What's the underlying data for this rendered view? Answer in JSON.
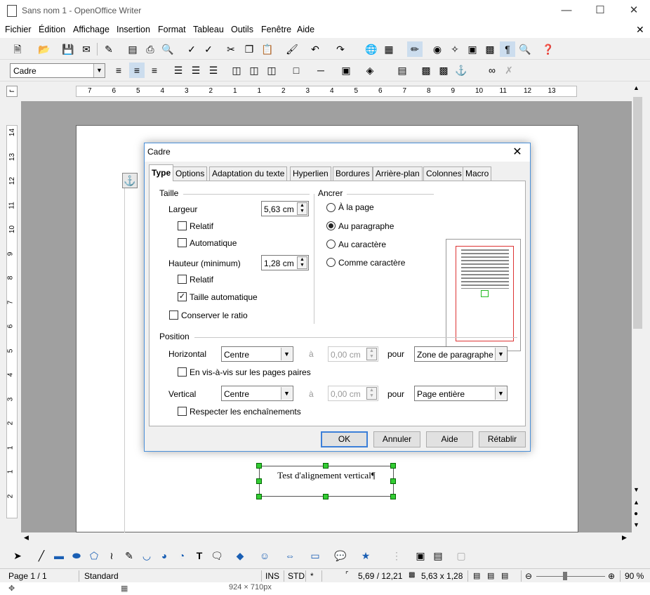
{
  "window": {
    "title": "Sans nom 1 - OpenOffice Writer"
  },
  "menubar": [
    "Fichier",
    "Édition",
    "Affichage",
    "Insertion",
    "Format",
    "Tableau",
    "Outils",
    "Fenêtre",
    "Aide"
  ],
  "format_toolbar": {
    "style": "Cadre"
  },
  "hruler": {
    "labels": [
      "7",
      "6",
      "5",
      "4",
      "3",
      "2",
      "1",
      "1",
      "2",
      "3",
      "4",
      "5",
      "6",
      "7",
      "8",
      "9",
      "10",
      "11",
      "12",
      "13"
    ]
  },
  "vruler": {
    "labels": [
      "14",
      "13",
      "12",
      "11",
      "10",
      "9",
      "8",
      "7",
      "6",
      "5",
      "4",
      "3",
      "2",
      "1",
      "1",
      "2"
    ]
  },
  "document": {
    "frame_text": "Test d'alignement vertical¶"
  },
  "statusbar": {
    "page": "Page 1 / 1",
    "style": "Standard",
    "ins": "INS",
    "std": "STD",
    "star": "*",
    "position": "5,69 / 12,21",
    "size": "5,63 x 1,28",
    "zoom": "90 %"
  },
  "taskstrip": {
    "text": "924 × 710px"
  },
  "dialog": {
    "title": "Cadre",
    "tabs": [
      "Type",
      "Options",
      "Adaptation du texte",
      "Hyperlien",
      "Bordures",
      "Arrière-plan",
      "Colonnes",
      "Macro"
    ],
    "taille": {
      "heading": "Taille",
      "largeur_label": "Largeur",
      "largeur_value": "5,63 cm",
      "relatif1": "Relatif",
      "automatique": "Automatique",
      "hauteur_label": "Hauteur (minimum)",
      "hauteur_value": "1,28 cm",
      "relatif2": "Relatif",
      "taille_auto": "Taille automatique",
      "conserver": "Conserver le ratio"
    },
    "ancrer": {
      "heading": "Ancrer",
      "opt_page": "À la page",
      "opt_paragraphe": "Au paragraphe",
      "opt_caractere": "Au caractère",
      "opt_comme": "Comme caractère"
    },
    "position": {
      "heading": "Position",
      "horizontal_label": "Horizontal",
      "horizontal_value": "Centre",
      "a1": "à",
      "h_offset": "0,00 cm",
      "pour1": "pour",
      "h_ref": "Zone de paragraphe",
      "visavis": "En vis-à-vis sur les pages paires",
      "vertical_label": "Vertical",
      "vertical_value": "Centre",
      "a2": "à",
      "v_offset": "0,00 cm",
      "pour2": "pour",
      "v_ref": "Page entière",
      "respecter": "Respecter les enchaînements"
    },
    "buttons": {
      "ok": "OK",
      "annuler": "Annuler",
      "aide": "Aide",
      "retablir": "Rétablir"
    }
  }
}
